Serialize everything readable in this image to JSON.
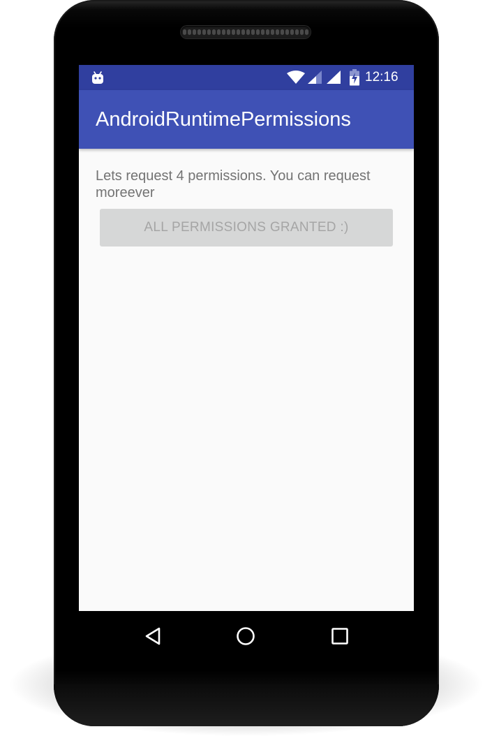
{
  "status_bar": {
    "time": "12:16",
    "icons": [
      "android-debug-icon",
      "wifi-icon",
      "cell-signal-icon",
      "cell-signal-icon",
      "battery-charging-icon"
    ]
  },
  "app_bar": {
    "title": "AndroidRuntimePermissions"
  },
  "main": {
    "intro_text": "Lets request 4 permissions. You can request moreever",
    "button_label": "ALL PERMISSIONS GRANTED :)"
  },
  "nav_bar": {
    "icons": [
      "back-icon",
      "home-icon",
      "recents-icon"
    ]
  },
  "colors": {
    "status_bar": "#303f9f",
    "app_bar": "#3f51b5",
    "screen_background": "#fafafa",
    "button_background": "#d6d7d7",
    "button_text": "#a5a5a5",
    "body_text": "#737373"
  }
}
